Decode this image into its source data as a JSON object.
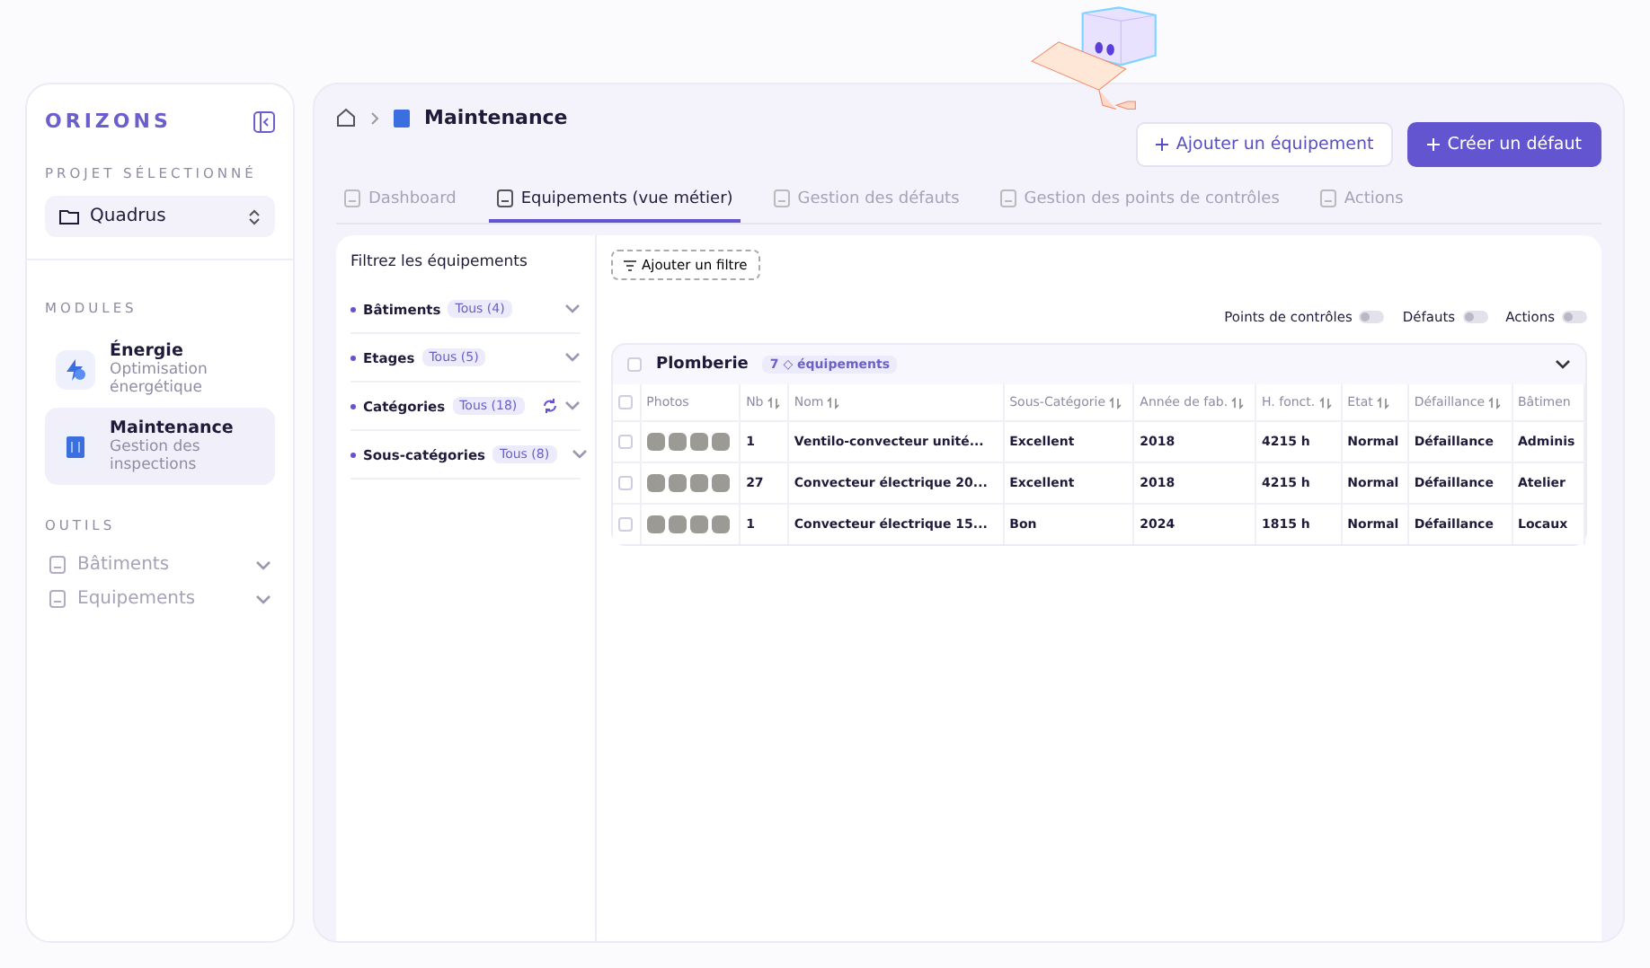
{
  "sidebar": {
    "logo": "ORIZONS",
    "project_label": "PROJET SÉLECTIONNÉ",
    "project": "Quadrus",
    "modules_label": "MODULES",
    "modules": [
      {
        "name": "Énergie",
        "subtitle": "Optimisation énergétique",
        "selected": false
      },
      {
        "name": "Maintenance",
        "subtitle": "Gestion des inspections",
        "selected": true
      }
    ],
    "tools_label": "OUTILS",
    "tools": [
      {
        "label": "Bâtiments"
      },
      {
        "label": "Equipements"
      }
    ]
  },
  "header": {
    "breadcrumb": "Maintenance",
    "buttons": [
      {
        "label": "Ajouter un équipement",
        "kind": "secondary"
      },
      {
        "label": "Créer un défaut",
        "kind": "primary"
      }
    ]
  },
  "tabs": [
    {
      "label": "Dashboard",
      "selected": false
    },
    {
      "label": "Equipements (vue métier)",
      "selected": true
    },
    {
      "label": "Gestion des défauts",
      "selected": false
    },
    {
      "label": "Gestion des points de contrôles",
      "selected": false
    },
    {
      "label": "Actions",
      "selected": false
    }
  ],
  "filters": {
    "title": "Filtrez les équipements",
    "items": [
      {
        "label": "Bâtiments",
        "badge": "Tous (4)",
        "refresh": false
      },
      {
        "label": "Etages",
        "badge": "Tous (5)",
        "refresh": false
      },
      {
        "label": "Catégories",
        "badge": "Tous (18)",
        "refresh": true
      },
      {
        "label": "Sous-catégories",
        "badge": "Tous (8)",
        "refresh": false
      }
    ]
  },
  "add_filter": "Ajouter un filtre",
  "toggles": [
    {
      "label": "Points de contrôles",
      "on": false
    },
    {
      "label": "Défauts",
      "on": false
    },
    {
      "label": "Actions",
      "on": false
    }
  ],
  "group": {
    "name": "Plomberie",
    "badge": "7 ◇ équipements",
    "expanded": true,
    "checked": false
  },
  "table": {
    "select_all": false,
    "photo_column": "Photos",
    "columns": [
      "Nb",
      "Nom",
      "Sous-Catégorie",
      "Année de fab.",
      "H. fonct.",
      "Etat",
      "Défaillance",
      "Bâtimen"
    ],
    "rows": [
      {
        "checked": false,
        "cells": [
          "1",
          "Ventilo-convecteur unité...",
          "Excellent",
          "2018",
          "4215 h",
          "Normal",
          "Défaillance",
          "Adminis"
        ]
      },
      {
        "checked": false,
        "cells": [
          "27",
          "Convecteur électrique 20...",
          "Excellent",
          "2018",
          "4215 h",
          "Normal",
          "Défaillance",
          "Atelier"
        ]
      },
      {
        "checked": false,
        "cells": [
          "1",
          "Convecteur électrique 15...",
          "Bon",
          "2024",
          "1815 h",
          "Normal",
          "Défaillance",
          "Locaux"
        ]
      }
    ]
  }
}
